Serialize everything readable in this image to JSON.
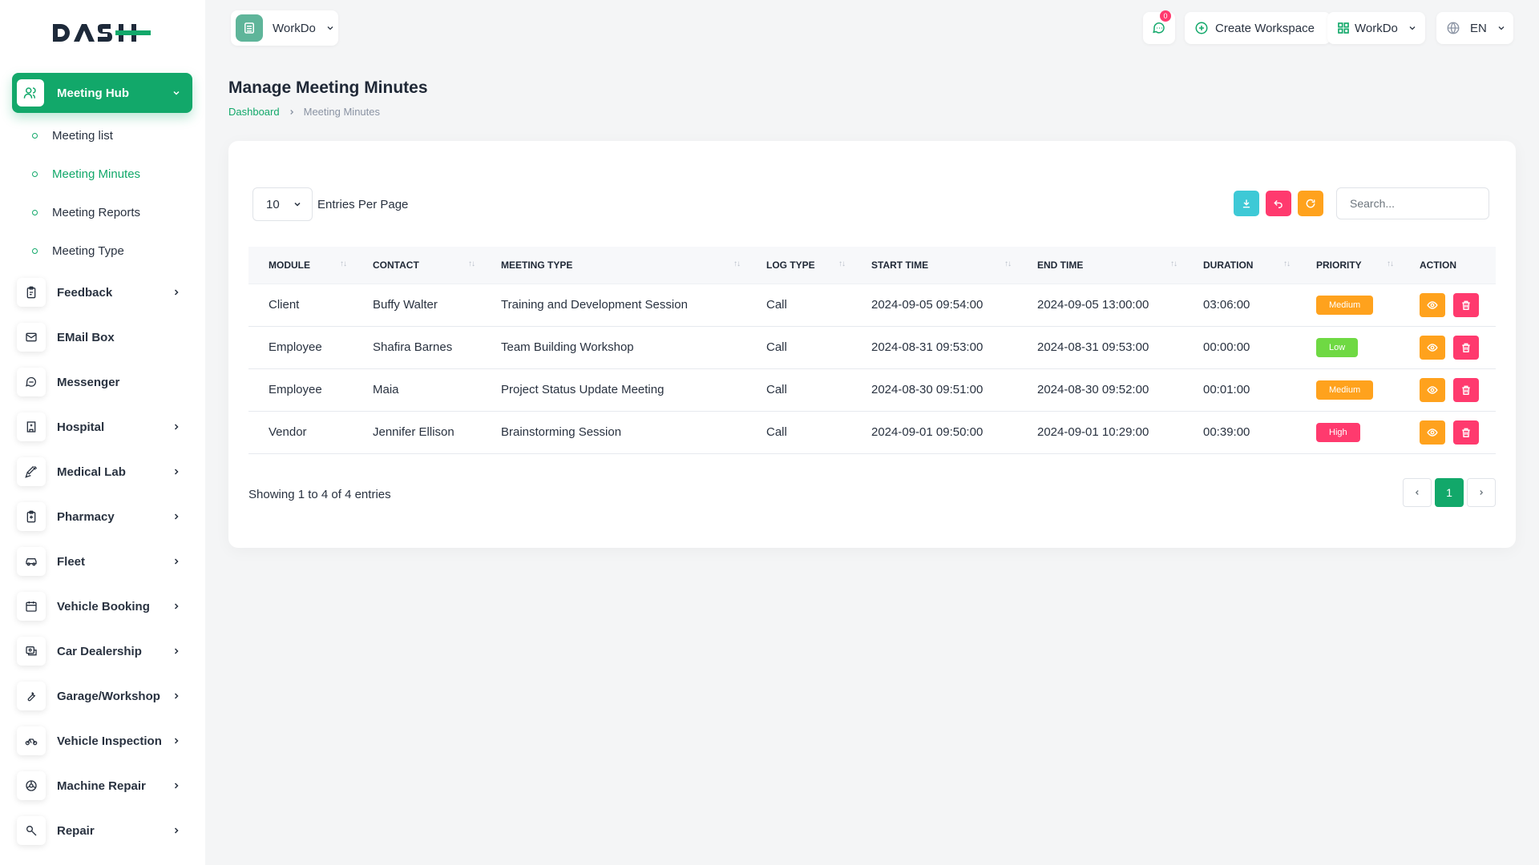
{
  "brand": {
    "logo_main": "DASH",
    "accent_color": "#12a86a"
  },
  "sidebar": {
    "active": {
      "label": "Meeting Hub",
      "icon": "users-icon"
    },
    "subitems": [
      {
        "label": "Meeting list",
        "active": false
      },
      {
        "label": "Meeting Minutes",
        "active": true
      },
      {
        "label": "Meeting Reports",
        "active": false
      },
      {
        "label": "Meeting Type",
        "active": false
      }
    ],
    "items": [
      {
        "label": "Feedback",
        "icon": "clipboard-icon",
        "has_children": true
      },
      {
        "label": "EMail Box",
        "icon": "mail-icon",
        "has_children": false
      },
      {
        "label": "Messenger",
        "icon": "chat-icon",
        "has_children": false
      },
      {
        "label": "Hospital",
        "icon": "building-icon",
        "has_children": true
      },
      {
        "label": "Medical Lab",
        "icon": "syringe-icon",
        "has_children": true
      },
      {
        "label": "Pharmacy",
        "icon": "clipboard-plus-icon",
        "has_children": true
      },
      {
        "label": "Fleet",
        "icon": "car-icon",
        "has_children": true
      },
      {
        "label": "Vehicle Booking",
        "icon": "calendar-icon",
        "has_children": true
      },
      {
        "label": "Car Dealership",
        "icon": "car-tag-icon",
        "has_children": true
      },
      {
        "label": "Garage/Workshop",
        "icon": "wrench-icon",
        "has_children": true
      },
      {
        "label": "Vehicle Inspection",
        "icon": "bike-icon",
        "has_children": true
      },
      {
        "label": "Machine Repair",
        "icon": "wheel-icon",
        "has_children": true
      },
      {
        "label": "Repair",
        "icon": "tool-icon",
        "has_children": true
      }
    ]
  },
  "header": {
    "workspace": "WorkDo",
    "messages_count": "0",
    "create_workspace": "Create Workspace",
    "user_workspace": "WorkDo",
    "language": "EN"
  },
  "page": {
    "title": "Manage Meeting Minutes",
    "breadcrumb": [
      "Dashboard",
      "Meeting Minutes"
    ]
  },
  "table_controls": {
    "entries_value": "10",
    "entries_label": "Entries Per Page",
    "search_placeholder": "Search..."
  },
  "table": {
    "columns": [
      "Module",
      "Contact",
      "Meeting Type",
      "Log Type",
      "Start Time",
      "End Time",
      "Duration",
      "Priority",
      "Action"
    ],
    "rows": [
      {
        "module": "Client",
        "contact": "Buffy Walter",
        "meeting_type": "Training and Development Session",
        "log_type": "Call",
        "start": "2024-09-05 09:54:00",
        "end": "2024-09-05 13:00:00",
        "duration": "03:06:00",
        "priority": "Medium"
      },
      {
        "module": "Employee",
        "contact": "Shafira Barnes",
        "meeting_type": "Team Building Workshop",
        "log_type": "Call",
        "start": "2024-08-31 09:53:00",
        "end": "2024-08-31 09:53:00",
        "duration": "00:00:00",
        "priority": "Low"
      },
      {
        "module": "Employee",
        "contact": "Maia",
        "meeting_type": "Project Status Update Meeting",
        "log_type": "Call",
        "start": "2024-08-30 09:51:00",
        "end": "2024-08-30 09:52:00",
        "duration": "00:01:00",
        "priority": "Medium"
      },
      {
        "module": "Vendor",
        "contact": "Jennifer Ellison",
        "meeting_type": "Brainstorming Session",
        "log_type": "Call",
        "start": "2024-09-01 09:50:00",
        "end": "2024-09-01 10:29:00",
        "duration": "00:39:00",
        "priority": "High"
      }
    ]
  },
  "priority_colors": {
    "Medium": "#ffa21d",
    "Low": "#6fd943",
    "High": "#ff3a6e"
  },
  "footer": {
    "showing": "Showing 1 to 4 of 4 entries",
    "pages": [
      "1"
    ],
    "prev_icon": "chevron-left-icon",
    "next_icon": "chevron-right-icon"
  }
}
